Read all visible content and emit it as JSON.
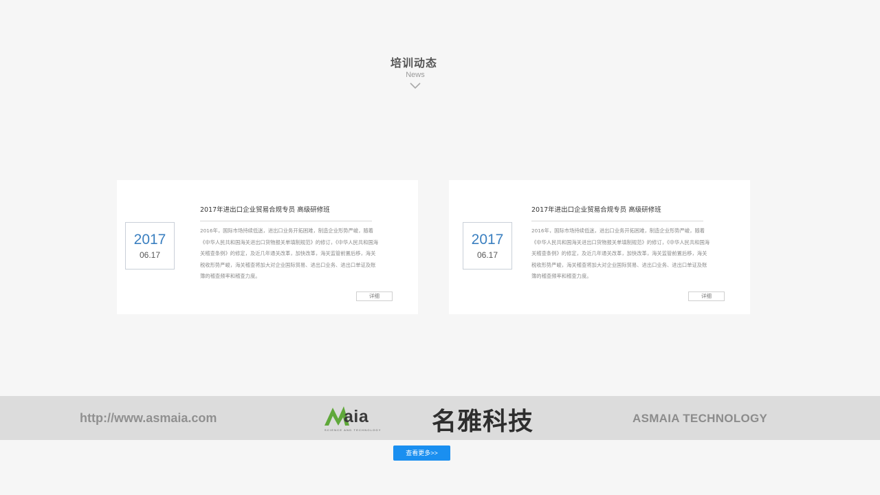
{
  "section": {
    "title": "培训动态",
    "subtitle": "News",
    "chevron_icon": "chevron-down-icon"
  },
  "cards": [
    {
      "year": "2017",
      "month_day": "06.17",
      "title": "2017年进出口企业贸易合规专员 高级研修班",
      "body": "2016年，国际市场持续低迷，进出口业务开拓困难，制造企业形势严峻，随着《中华人民共和国海关进出口货物报关单填制规范》的修订，《中华人民共和国海关稽查条例》的修定，及近几年通关改革，加快改革，海关监管前置后移，海关税收形势严峻，海关稽查将加大对企业国际贸易、进出口业务、进出口单证及账簿的稽查频率和稽查力度。",
      "detail_label": "详细"
    },
    {
      "year": "2017",
      "month_day": "06.17",
      "title": "2017年进出口企业贸易合规专员 高级研修班",
      "body": "2016年，国际市场持续低迷，进出口业务开拓困难，制造企业形势严峻，随着《中华人民共和国海关进出口货物报关单填制规范》的修订，《中华人民共和国海关稽查条例》的修定，及近几年通关改革，加快改革，海关监管前置后移，海关税收形势严峻，海关稽查将加大对企业国际贸易、进出口业务、进出口单证及账簿的稽查频率和稽查力度。",
      "detail_label": "详细"
    }
  ],
  "banner": {
    "url": "http://www.asmaia.com",
    "logo_word": "aia",
    "logo_tagline": "SCIENCE AND TECHNOLOGY",
    "brand_cn": "名雅科技",
    "brand_en": "ASMAIA  TECHNOLOGY"
  },
  "more_button_label": "查看更多>>",
  "colors": {
    "accent_blue": "#1a8ff0",
    "year_blue": "#3a7fc0",
    "logo_green": "#5fa83a",
    "banner_gray": "#dcdcdc"
  }
}
